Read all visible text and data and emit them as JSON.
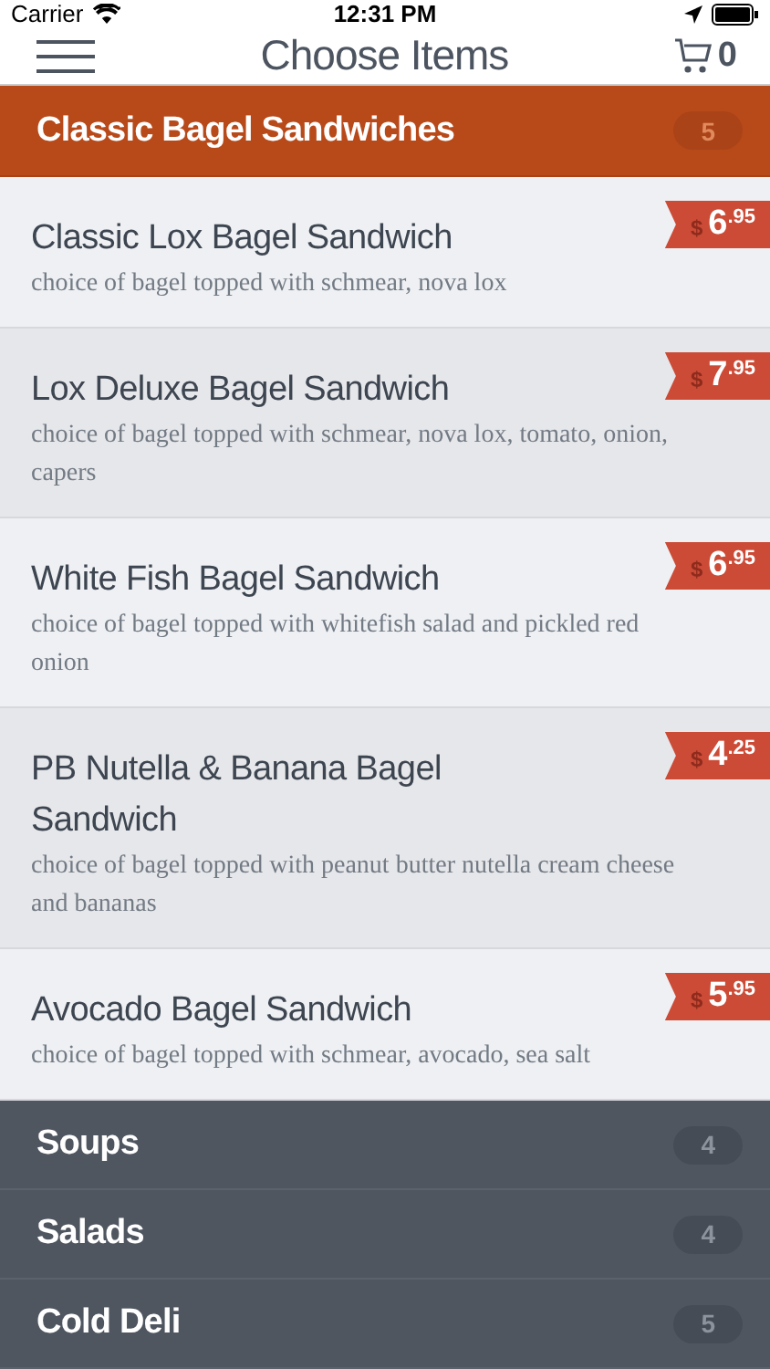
{
  "status_bar": {
    "carrier": "Carrier",
    "time": "12:31 PM"
  },
  "nav": {
    "title": "Choose Items",
    "cart_count": "0"
  },
  "categories": [
    {
      "name": "Classic Bagel Sandwiches",
      "count": "5",
      "expanded": true,
      "items": [
        {
          "name": "Classic Lox Bagel Sandwich",
          "description": "choice of bagel topped with schmear, nova lox",
          "price": {
            "symbol": "$",
            "whole": "6",
            "fraction": ".95"
          }
        },
        {
          "name": "Lox Deluxe Bagel Sandwich",
          "description": "choice of bagel topped with schmear, nova lox, tomato, onion, capers",
          "price": {
            "symbol": "$",
            "whole": "7",
            "fraction": ".95"
          }
        },
        {
          "name": "White Fish Bagel Sandwich",
          "description": "choice of bagel topped with whitefish salad and pickled red onion",
          "price": {
            "symbol": "$",
            "whole": "6",
            "fraction": ".95"
          }
        },
        {
          "name": "PB Nutella & Banana Bagel Sandwich",
          "description": "choice of bagel topped with peanut butter nutella cream cheese and bananas",
          "price": {
            "symbol": "$",
            "whole": "4",
            "fraction": ".25"
          }
        },
        {
          "name": "Avocado Bagel Sandwich",
          "description": "choice of bagel topped with schmear, avocado, sea salt",
          "price": {
            "symbol": "$",
            "whole": "5",
            "fraction": ".95"
          }
        }
      ]
    },
    {
      "name": "Soups",
      "count": "4",
      "expanded": false
    },
    {
      "name": "Salads",
      "count": "4",
      "expanded": false
    },
    {
      "name": "Cold Deli",
      "count": "5",
      "expanded": false
    }
  ]
}
